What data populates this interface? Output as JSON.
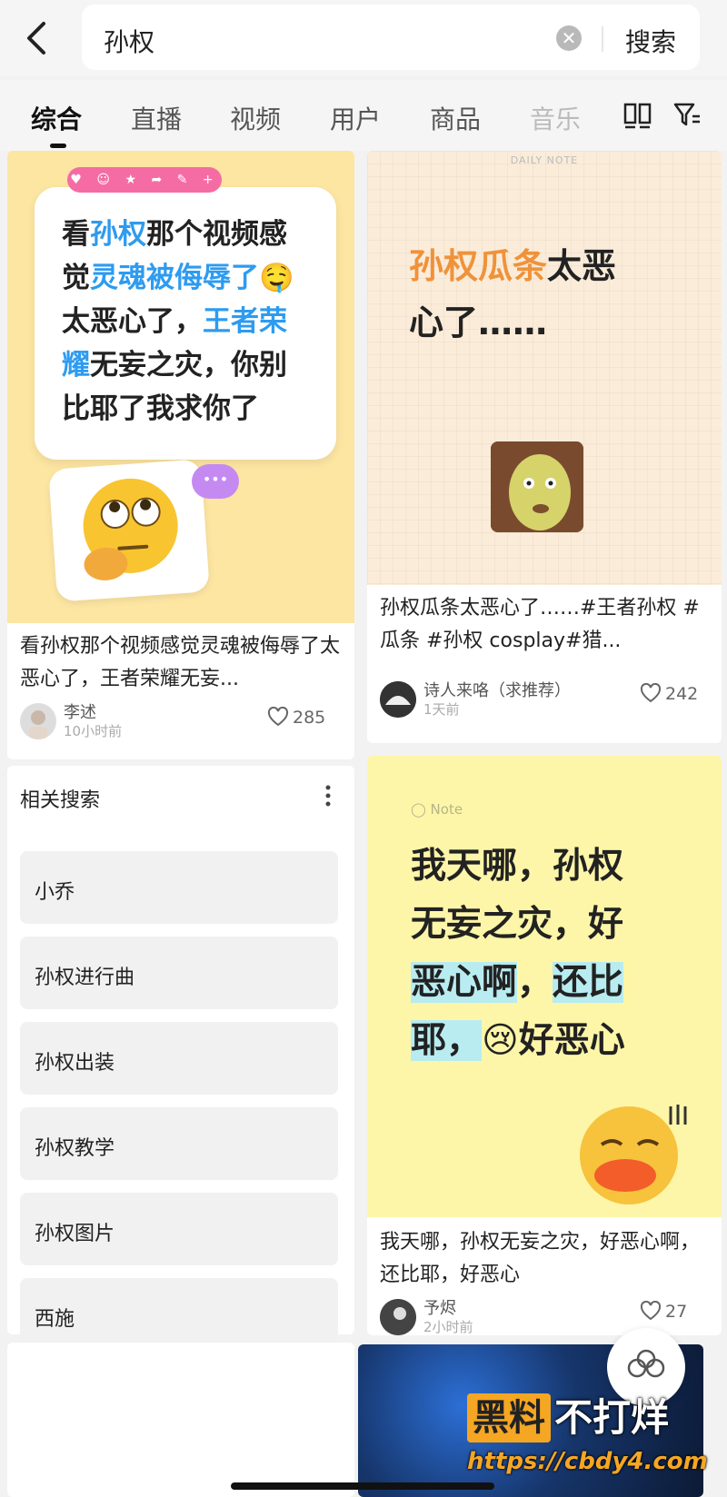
{
  "search": {
    "query": "孙权",
    "button": "搜索"
  },
  "tabs": [
    {
      "label": "综合"
    },
    {
      "label": "直播"
    },
    {
      "label": "视频"
    },
    {
      "label": "用户"
    },
    {
      "label": "商品"
    },
    {
      "label": "音乐"
    }
  ],
  "feed": {
    "card1": {
      "cover": {
        "line1a": "看",
        "line1b": "孙权",
        "line1c": "那个视频感",
        "line2a": "觉",
        "line2b": "灵魂被侮辱了",
        "line2emoji": "🤤",
        "line3a": "太恶心了，",
        "line3b": "王者荣",
        "line4a": "耀",
        "line4b": "无妄之灾，你别",
        "line5": "比耶了我求你了",
        "bubble_bar_icons": "♥ ☺ ★ ➦ ✎ +",
        "big_emoji": "🙄",
        "purple_dots": "•••"
      },
      "title": "看孙权那个视频感觉灵魂被侮辱了太恶心了，王者荣耀无妄...",
      "author": "李述",
      "time": "10小时前",
      "likes": "285"
    },
    "card2": {
      "cover": {
        "daily_note": "DAILY NOTE",
        "line1a": "孙权瓜条",
        "line1b": "太恶",
        "line2": "心了……"
      },
      "title": "孙权瓜条太恶心了……#王者孙权 #瓜条 #孙权 cosplay#猎...",
      "author": "诗人来咯（求推荐）",
      "time": "1天前",
      "likes": "242"
    },
    "card3": {
      "cover": {
        "note_label": "◯ Note",
        "line1": "我天哪，孙权",
        "line2": "无妄之灾，好",
        "line3a": "恶心啊",
        "line3b": "，",
        "line3c": "还比",
        "line4a": "耶，",
        "line4emoji": "😢",
        "line4b": "好恶心",
        "big_emoji": "😗"
      },
      "title": "我天哪，孙权无妄之灾，好恶心啊，还比耶，好恶心",
      "author": "予烬",
      "time": "2小时前",
      "likes": "27"
    }
  },
  "related": {
    "title": "相关搜索",
    "items": [
      {
        "label": "小乔"
      },
      {
        "label": "孙权进行曲"
      },
      {
        "label": "孙权出装"
      },
      {
        "label": "孙权教学"
      },
      {
        "label": "孙权图片"
      },
      {
        "label": "西施"
      }
    ]
  },
  "watermark": {
    "box": "黑料",
    "rest": "不打烊",
    "url": "https://cbdy4.com"
  },
  "colors": {
    "accent_blue": "#2d9bf0",
    "accent_orange": "#f0923a",
    "badge_pink": "#f56ca5"
  }
}
